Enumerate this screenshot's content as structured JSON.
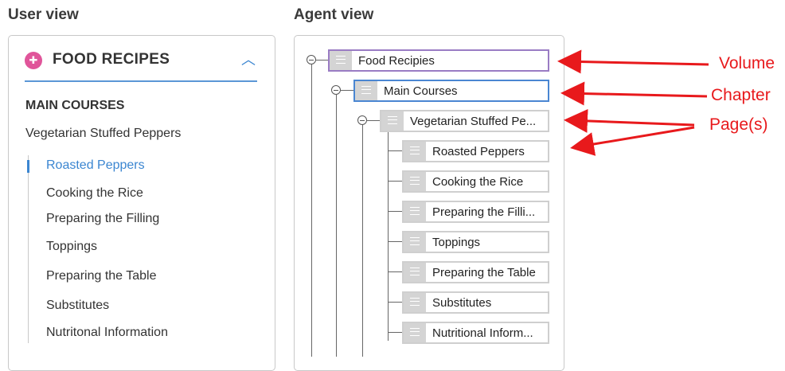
{
  "user_view": {
    "section_title": "User view",
    "header_title": "FOOD RECIPES",
    "chapter": "MAIN COURSES",
    "page_group": "Vegetarian Stuffed Peppers",
    "pages": [
      "Roasted Peppers",
      "Cooking the Rice",
      "Preparing the Filling",
      "Toppings",
      "Preparing the Table",
      "Substitutes",
      "Nutritonal Information"
    ],
    "active_page": "Roasted Peppers"
  },
  "agent_view": {
    "section_title": "Agent view",
    "volume": "Food Recipies",
    "chapter": "Main Courses",
    "page_group": "Vegetarian Stuffed Pe...",
    "pages": [
      "Roasted Peppers",
      "Cooking the Rice",
      "Preparing the Filli...",
      "Toppings",
      "Preparing the Table",
      "Substitutes",
      "Nutritional Inform..."
    ]
  },
  "annotations": {
    "volume": "Volume",
    "chapter": "Chapter",
    "pages": "Page(s)",
    "color": "#e8191c"
  }
}
